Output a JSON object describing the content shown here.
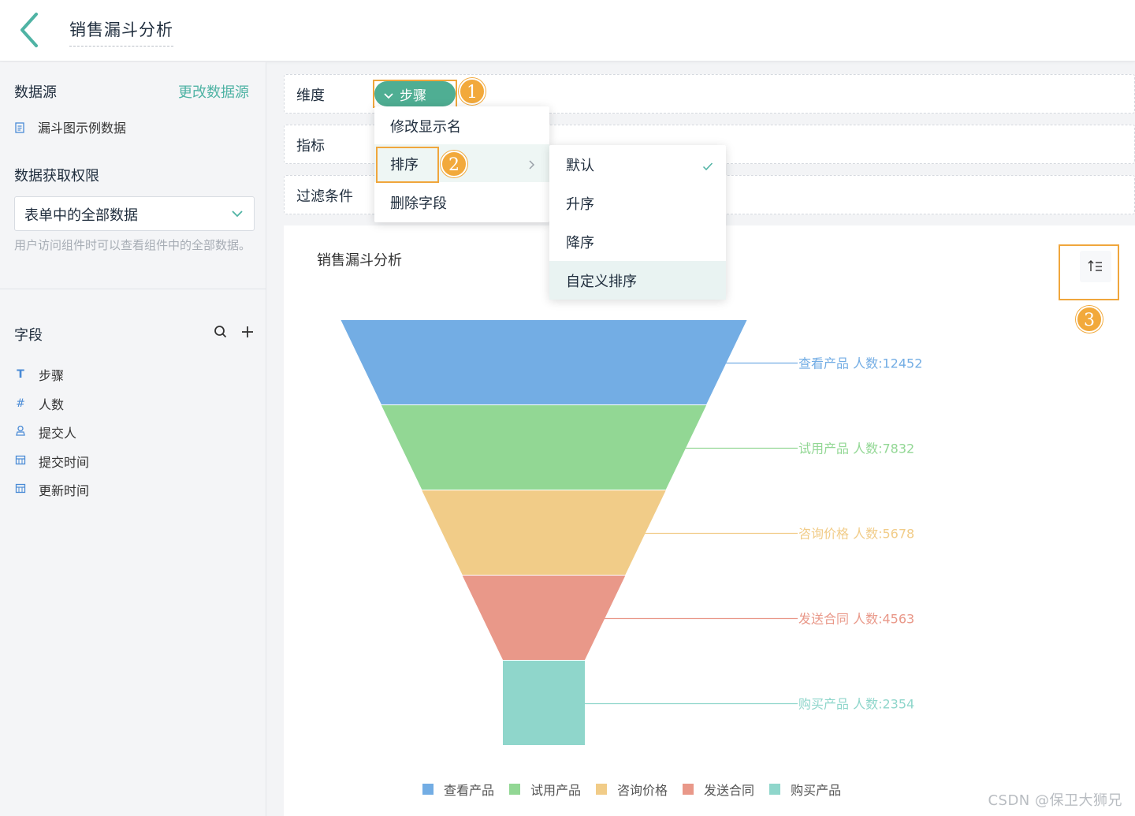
{
  "header": {
    "title": "销售漏斗分析"
  },
  "sidebar": {
    "datasource_label": "数据源",
    "change_datasource": "更改数据源",
    "datasource_name": "漏斗图示例数据",
    "permission_label": "数据获取权限",
    "permission_value": "表单中的全部数据",
    "permission_help": "用户访问组件时可以查看组件中的全部数据。",
    "fields_label": "字段",
    "fields": [
      {
        "type_icon": "T",
        "label": "步骤",
        "icon": "text-icon"
      },
      {
        "type_icon": "#",
        "label": "人数",
        "icon": "number-icon"
      },
      {
        "type_icon": "person",
        "label": "提交人",
        "icon": "person-icon"
      },
      {
        "type_icon": "cal",
        "label": "提交时间",
        "icon": "calendar-icon"
      },
      {
        "type_icon": "cal",
        "label": "更新时间",
        "icon": "calendar-icon"
      }
    ]
  },
  "config": {
    "dimension_label": "维度",
    "dimension_pill": "步骤",
    "metric_label": "指标",
    "filter_label": "过滤条件"
  },
  "context_menu": {
    "items": [
      "修改显示名",
      "排序",
      "删除字段"
    ]
  },
  "sort_submenu": {
    "items": [
      "默认",
      "升序",
      "降序",
      "自定义排序"
    ],
    "checked": "默认"
  },
  "badges": [
    "1",
    "2",
    "3"
  ],
  "chart_data": {
    "type": "funnel",
    "title": "销售漏斗分析",
    "categories": [
      "查看产品",
      "试用产品",
      "咨询价格",
      "发送合同",
      "购买产品"
    ],
    "values": [
      12452,
      7832,
      5678,
      4563,
      2354
    ],
    "labels": [
      "查看产品 人数:12452",
      "试用产品 人数:7832",
      "咨询价格 人数:5678",
      "发送合同 人数:4563",
      "购买产品 人数:2354"
    ],
    "colors": [
      "#73ade4",
      "#92d794",
      "#f1cc88",
      "#e99889",
      "#8fd6cb"
    ],
    "legend_position": "bottom"
  },
  "watermark": "CSDN @保卫大狮兄"
}
